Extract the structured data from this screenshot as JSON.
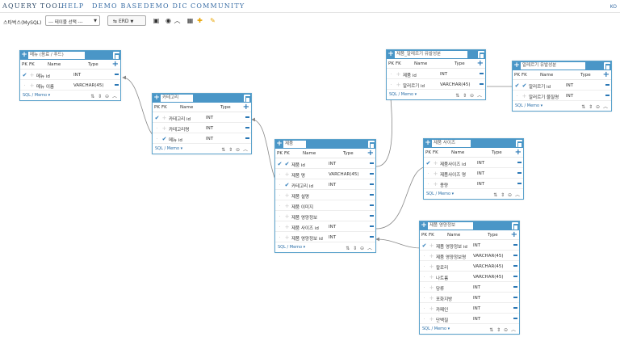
{
  "nav": {
    "brand": "AQUERY TOOL",
    "items": [
      "HELP",
      "DEMO BASE",
      "DEMO DIC",
      "COMMUNITY"
    ],
    "lang": "KO"
  },
  "toolbar": {
    "schema_label": "스타벅스(MySQL)",
    "table_select": "--- 테이블 선택 ---",
    "erd_button": "ERD"
  },
  "tables": [
    {
      "name": "메뉴 (음료 / 푸드)",
      "columns": [
        {
          "pk": true,
          "fk": false,
          "name": "메뉴 id",
          "type": "INT"
        },
        {
          "pk": false,
          "fk": false,
          "name": "메뉴 이름",
          "type": "VARCHAR(45)"
        }
      ]
    },
    {
      "name": "카테고리",
      "columns": [
        {
          "pk": true,
          "fk": false,
          "name": "카테고리 id",
          "type": "INT"
        },
        {
          "pk": false,
          "fk": false,
          "name": "카테고리명",
          "type": "INT"
        },
        {
          "pk": false,
          "fk": true,
          "name": "메뉴 id",
          "type": "INT"
        }
      ]
    },
    {
      "name": "제품_알레르기 유발성분",
      "columns": [
        {
          "pk": false,
          "fk": false,
          "name": "제품 id",
          "type": "INT"
        },
        {
          "pk": false,
          "fk": false,
          "name": "알러르기 id",
          "type": "VARCHAR(45)"
        }
      ]
    },
    {
      "name": "알레르기 유발성분",
      "columns": [
        {
          "pk": true,
          "fk": true,
          "name": "알러르기 id",
          "type": "INT"
        },
        {
          "pk": false,
          "fk": false,
          "name": "알러르기 물질명",
          "type": "INT"
        }
      ]
    },
    {
      "name": "제품",
      "columns": [
        {
          "pk": true,
          "fk": true,
          "name": "제품 id",
          "type": "INT"
        },
        {
          "pk": false,
          "fk": false,
          "name": "제품 명",
          "type": "VARCHAR(45)"
        },
        {
          "pk": false,
          "fk": true,
          "name": "카테고리 id",
          "type": "INT"
        },
        {
          "pk": false,
          "fk": false,
          "name": "제품 설명",
          "type": ""
        },
        {
          "pk": false,
          "fk": false,
          "name": "제품 이미지",
          "type": ""
        },
        {
          "pk": false,
          "fk": false,
          "name": "제품 영양정보",
          "type": ""
        },
        {
          "pk": false,
          "fk": false,
          "name": "제품 사이즈 id",
          "type": "INT"
        },
        {
          "pk": false,
          "fk": false,
          "name": "제품 영양정보 id",
          "type": "INT"
        }
      ]
    },
    {
      "name": "제품 사이즈",
      "columns": [
        {
          "pk": true,
          "fk": false,
          "name": "제품사이즈 id",
          "type": "INT"
        },
        {
          "pk": false,
          "fk": false,
          "name": "제품사이즈 명",
          "type": "INT"
        },
        {
          "pk": false,
          "fk": false,
          "name": "용량",
          "type": "INT"
        }
      ]
    },
    {
      "name": "제품 영양정보",
      "columns": [
        {
          "pk": true,
          "fk": false,
          "name": "제품 영양정보 id",
          "type": "INT"
        },
        {
          "pk": false,
          "fk": false,
          "name": "제품 영양정보명",
          "type": "VARCHAR(45)"
        },
        {
          "pk": false,
          "fk": false,
          "name": "칼로리",
          "type": "VARCHAR(45)"
        },
        {
          "pk": false,
          "fk": false,
          "name": "나트륨",
          "type": "VARCHAR(45)"
        },
        {
          "pk": false,
          "fk": false,
          "name": "당류",
          "type": "INT"
        },
        {
          "pk": false,
          "fk": false,
          "name": "포화지방",
          "type": "INT"
        },
        {
          "pk": false,
          "fk": false,
          "name": "카페인",
          "type": "INT"
        },
        {
          "pk": false,
          "fk": false,
          "name": "단백질",
          "type": "INT"
        }
      ]
    }
  ],
  "labels": {
    "pk": "PK",
    "fk": "FK",
    "name": "Name",
    "type": "Type",
    "memo": "SQL / Memo ▾"
  },
  "colors": {
    "header": "#4a96c7",
    "accent": "#2a77b5",
    "link": "#888888"
  }
}
